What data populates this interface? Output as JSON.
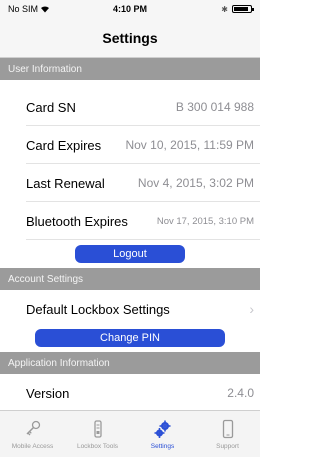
{
  "status_bar": {
    "carrier": "No SIM",
    "time": "4:10 PM",
    "battery_level": 0.9
  },
  "nav": {
    "title": "Settings"
  },
  "sections": {
    "user_information": "User Information",
    "account_settings": "Account Settings",
    "application_information": "Application Information"
  },
  "user_info": {
    "card_sn_label": "Card SN",
    "card_sn_value": "B 300 014 988",
    "card_expires_label": "Card Expires",
    "card_expires_value": "Nov 10, 2015, 11:59 PM",
    "last_renewal_label": "Last Renewal",
    "last_renewal_value": "Nov 4, 2015, 3:02 PM",
    "bluetooth_expires_label": "Bluetooth Expires",
    "bluetooth_expires_value": "Nov 17, 2015, 3:10 PM"
  },
  "buttons": {
    "logout": "Logout",
    "change_pin": "Change PIN"
  },
  "account": {
    "default_lockbox_label": "Default Lockbox Settings"
  },
  "app_info": {
    "version_label": "Version",
    "version_value": "2.4.0"
  },
  "tabs": [
    {
      "label": "Mobile Access",
      "icon": "key-icon",
      "active": false
    },
    {
      "label": "Lockbox Tools",
      "icon": "lockbox-icon",
      "active": false
    },
    {
      "label": "Settings",
      "icon": "gears-icon",
      "active": true
    },
    {
      "label": "Support",
      "icon": "phone-icon",
      "active": false
    }
  ],
  "colors": {
    "accent": "#2a4fd6",
    "section_header": "#9b9b9b",
    "bar_bg": "#f6f6f6"
  }
}
